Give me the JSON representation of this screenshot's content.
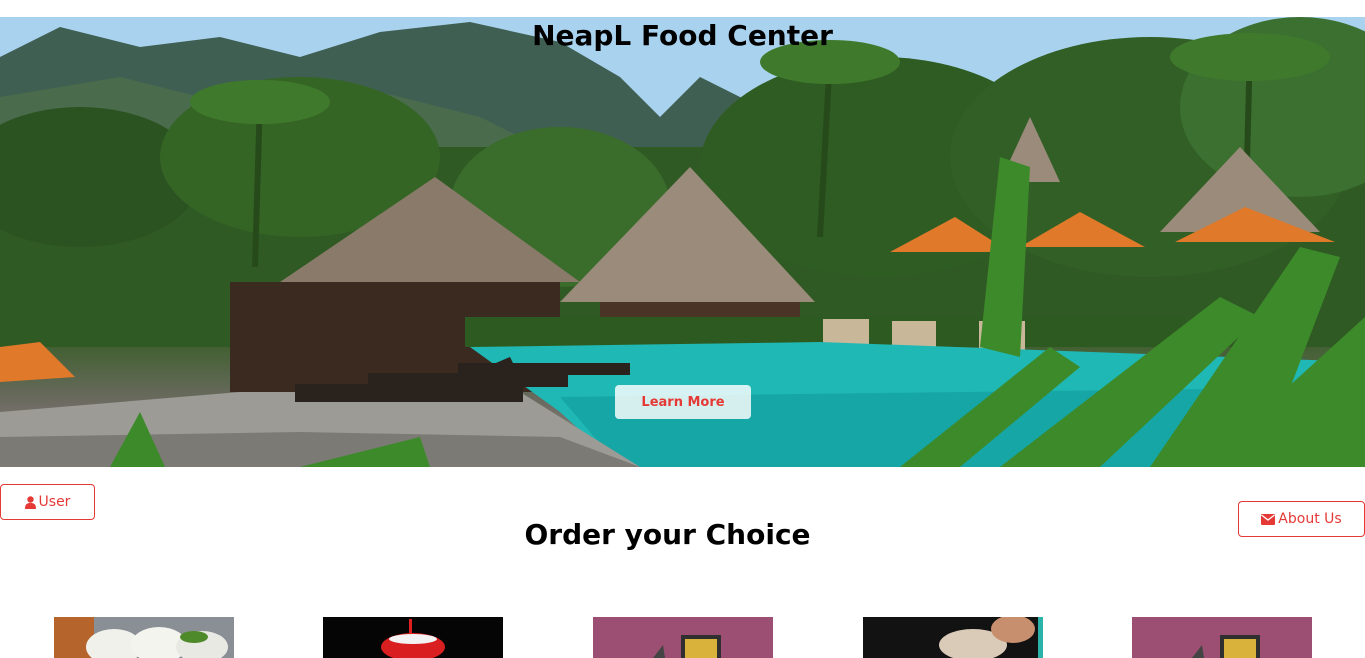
{
  "hero": {
    "title": "NeapL Food Center",
    "cta_label": "Learn More"
  },
  "nav": {
    "user_label": "User",
    "about_label": "About Us",
    "user_icon": "user-icon",
    "about_icon": "envelope-icon"
  },
  "menu": {
    "heading": "Order your Choice",
    "items": [
      {
        "image": "idli-plate"
      },
      {
        "image": "soft-drink"
      },
      {
        "image": "snack-package"
      },
      {
        "image": "dumpling-hand"
      },
      {
        "image": "snack-package"
      }
    ]
  },
  "colors": {
    "accent": "#e53935",
    "text": "#000000",
    "background": "#ffffff"
  }
}
